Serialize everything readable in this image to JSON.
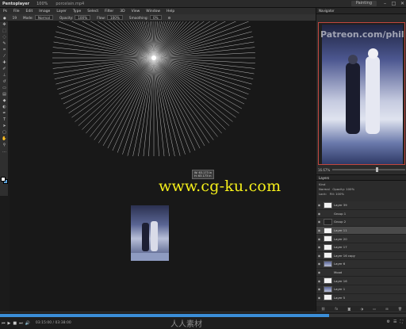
{
  "titlebar": {
    "app_name": "Pentoplayer",
    "zoom": "100%",
    "file": "porcelain.mp4",
    "workspace": "Painting",
    "minimize": "–",
    "maximize": "□",
    "close": "✕"
  },
  "menubar": [
    "Ps",
    "File",
    "Edit",
    "Image",
    "Layer",
    "Type",
    "Select",
    "Filter",
    "3D",
    "View",
    "Window",
    "Help"
  ],
  "options": {
    "mode_label": "Mode:",
    "mode_value": "Normal",
    "opacity_label": "Opacity:",
    "opacity_value": "100%",
    "flow_label": "Flow:",
    "flow_value": "100%",
    "smoothing_label": "Smoothing:",
    "smoothing_value": "0%",
    "brush_size": "19"
  },
  "canvas": {
    "readout_w": "W: 63.173 in",
    "readout_h": "H: 63.173 in",
    "watermark": "www.cg-ku.com"
  },
  "navigator": {
    "tab": "Navigator",
    "overlay_text": "Patreon.com/phil...",
    "zoom": "16.67%"
  },
  "layers": {
    "panel_title": "Layers",
    "kind_label": "Kind",
    "blend": "Normal",
    "opacity_label": "Opacity:",
    "opacity_value": "100%",
    "lock_label": "Lock:",
    "fill_label": "Fill:",
    "fill_value": "100%",
    "items": [
      {
        "name": "Layer 39",
        "thumb": "white",
        "selected": false
      },
      {
        "name": "Group 1",
        "thumb": "none",
        "selected": false
      },
      {
        "name": "Group 2",
        "thumb": "dark",
        "selected": false
      },
      {
        "name": "Layer 11",
        "thumb": "white",
        "selected": true
      },
      {
        "name": "Layer 20",
        "thumb": "white",
        "selected": false
      },
      {
        "name": "Layer 17",
        "thumb": "white",
        "selected": false
      },
      {
        "name": "Layer 16 copy",
        "thumb": "white",
        "selected": false
      },
      {
        "name": "Layer 6",
        "thumb": "img",
        "selected": false
      },
      {
        "name": "Mood",
        "thumb": "none",
        "selected": false
      },
      {
        "name": "Layer 16",
        "thumb": "white",
        "selected": false
      },
      {
        "name": "Layer 1",
        "thumb": "img",
        "selected": false
      },
      {
        "name": "Layer 5",
        "thumb": "white",
        "selected": false
      }
    ]
  },
  "timeline": {
    "position": "03:15:00",
    "duration": "03:38:00",
    "progress": 0.81,
    "logo_text": "人人素材",
    "progress_color": "#3b8ed8"
  },
  "colors": {
    "foreground": "#ffffff",
    "background": "#5aa0d8",
    "watermark": "#f5ef1a",
    "nav_frame": "#c2473f"
  }
}
